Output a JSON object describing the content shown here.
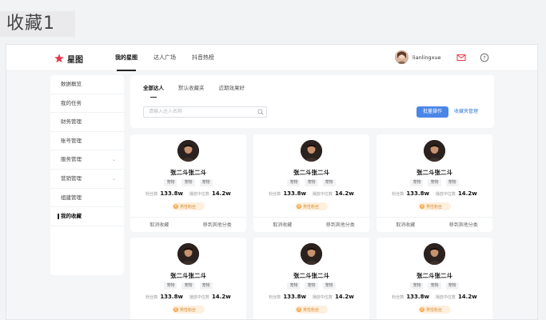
{
  "page_caption": "收藏1",
  "brand": {
    "logo_text": "星图",
    "accent": "#e8394a"
  },
  "nav": [
    {
      "label": "我的星图",
      "active": true
    },
    {
      "label": "达人广场",
      "active": false
    },
    {
      "label": "抖音热榜",
      "active": false
    }
  ],
  "user": {
    "name": "lianlingxue"
  },
  "sidebar": {
    "items": [
      {
        "label": "数据概览"
      },
      {
        "label": "我的任务"
      },
      {
        "label": "财务管理"
      },
      {
        "label": "账号管理"
      },
      {
        "label": "服务管理",
        "arrow": "⌄"
      },
      {
        "label": "营销管理",
        "arrow": "⌄"
      },
      {
        "label": "组建管理"
      },
      {
        "label": "我的收藏"
      }
    ]
  },
  "tabs": [
    {
      "label": "全部达人"
    },
    {
      "label": "默认收藏夹"
    },
    {
      "label": "近期效果好"
    }
  ],
  "search": {
    "placeholder": "请输入达人名称"
  },
  "actions": {
    "batch_label": "批量操作",
    "manage_label": "收藏夹管理"
  },
  "cards": [
    {
      "name": "张二斗张二斗",
      "tags": [
        "宠物",
        "宠物",
        "宠物"
      ],
      "fans_label": "粉丝数",
      "fans": "133.8w",
      "views_label": "播放中位数",
      "views": "14.2w",
      "badge": "男性粉丝",
      "badge_icon": "男",
      "action_cancel": "取消收藏",
      "action_move": "移到其他分类"
    },
    {
      "name": "张二斗张二斗",
      "tags": [
        "宠物",
        "宠物",
        "宠物"
      ],
      "fans_label": "粉丝数",
      "fans": "133.8w",
      "views_label": "播放中位数",
      "views": "14.2w",
      "badge": "男性粉丝",
      "badge_icon": "男",
      "action_cancel": "取消收藏",
      "action_move": "移到其他分类"
    },
    {
      "name": "张二斗张二斗",
      "tags": [
        "宠物",
        "宠物",
        "宠物"
      ],
      "fans_label": "粉丝数",
      "fans": "133.8w",
      "views_label": "播放中位数",
      "views": "14.2w",
      "badge": "男性粉丝",
      "badge_icon": "男",
      "action_cancel": "取消收藏",
      "action_move": "移到其他分类"
    },
    {
      "name": "张二斗张二斗",
      "tags": [
        "宠物",
        "宠物",
        "宠物"
      ],
      "fans_label": "粉丝数",
      "fans": "133.8w",
      "views_label": "播放中位数",
      "views": "14.2w",
      "badge": "男性粉丝",
      "badge_icon": "男"
    },
    {
      "name": "张二斗张二斗",
      "tags": [
        "宠物",
        "宠物",
        "宠物"
      ],
      "fans_label": "粉丝数",
      "fans": "133.8w",
      "views_label": "播放中位数",
      "views": "14.2w",
      "badge": "男性粉丝",
      "badge_icon": "男"
    },
    {
      "name": "张二斗张二斗",
      "tags": [
        "宠物",
        "宠物",
        "宠物"
      ],
      "fans_label": "粉丝数",
      "fans": "133.8w",
      "views_label": "播放中位数",
      "views": "14.2w",
      "badge": "男性粉丝",
      "badge_icon": "男"
    }
  ]
}
